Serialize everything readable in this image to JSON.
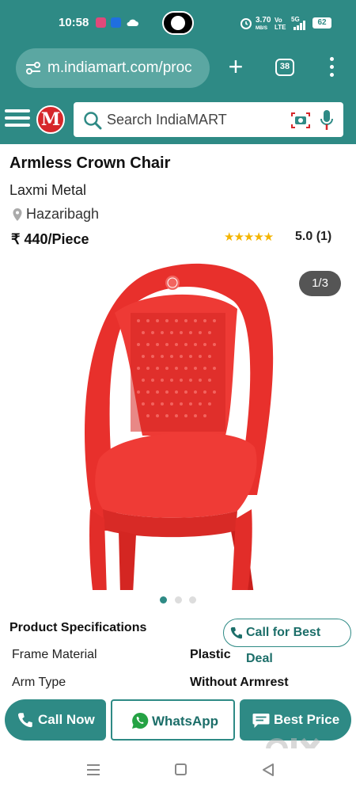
{
  "status_bar": {
    "time": "10:58",
    "net_speed": "3.70",
    "net_unit": "MB/S",
    "volte_top": "Vo",
    "volte_bottom": "LTE",
    "network": "5G",
    "battery": "62"
  },
  "browser": {
    "url": "m.indiamart.com/proc",
    "tab_count": "38"
  },
  "header": {
    "logo_letter": "M",
    "search_placeholder": "Search IndiaMART"
  },
  "product": {
    "title": "Armless Crown Chair",
    "seller": "Laxmi Metal",
    "location": "Hazaribagh",
    "price": "₹ 440/Piece",
    "stars": "★★★★★",
    "rating": "5.0 (1)",
    "rating_value": 5.0,
    "image_counter": "1/3",
    "image_index": 1,
    "image_total": 3,
    "chair_color": "#e8302c"
  },
  "specs": {
    "heading": "Product Specifications",
    "call_best_label": "Call for Best Deal",
    "rows": [
      {
        "key": "Frame Material",
        "value": "Plastic"
      },
      {
        "key": "Arm Type",
        "value": "Without Armrest"
      }
    ]
  },
  "actions": {
    "call_now": "Call Now",
    "whatsapp": "WhatsApp",
    "best_price": "Best Price"
  },
  "watermark": {
    "text": "olx"
  },
  "colors": {
    "brand_teal": "#2e8a85",
    "star_yellow": "#f4b400",
    "logo_red": "#d6272a"
  }
}
